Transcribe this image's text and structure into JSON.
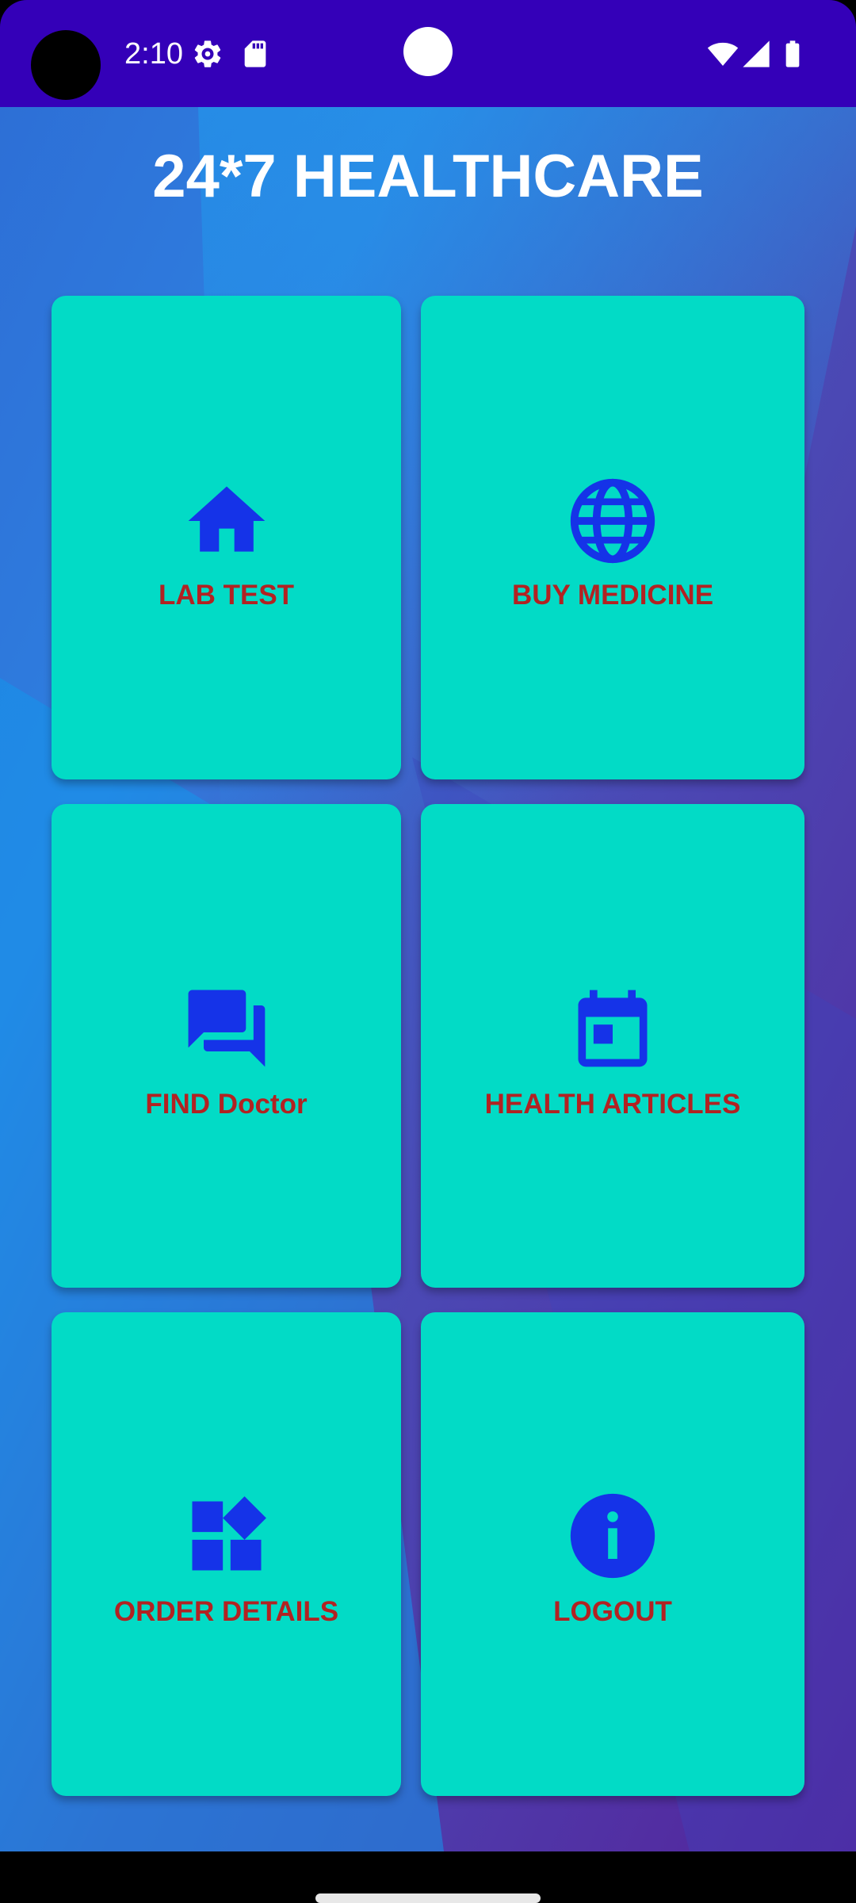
{
  "status_bar": {
    "time": "2:10",
    "icons": [
      "settings-gear-icon",
      "sd-card-icon",
      "wifi-icon",
      "cell-signal-icon",
      "battery-icon"
    ],
    "background_color": "#3400b8"
  },
  "app": {
    "title": "24*7 HEALTHCARE",
    "card_color": "#02dbc6",
    "label_color": "#b22222",
    "icon_color": "#1533e8",
    "cards": [
      {
        "label": "LAB TEST",
        "icon": "home-icon"
      },
      {
        "label": "BUY MEDICINE",
        "icon": "globe-icon"
      },
      {
        "label": "FIND Doctor",
        "icon": "chat-icon"
      },
      {
        "label": "HEALTH ARTICLES",
        "icon": "calendar-icon"
      },
      {
        "label": "ORDER DETAILS",
        "icon": "widgets-icon"
      },
      {
        "label": "LOGOUT",
        "icon": "info-icon"
      }
    ]
  }
}
